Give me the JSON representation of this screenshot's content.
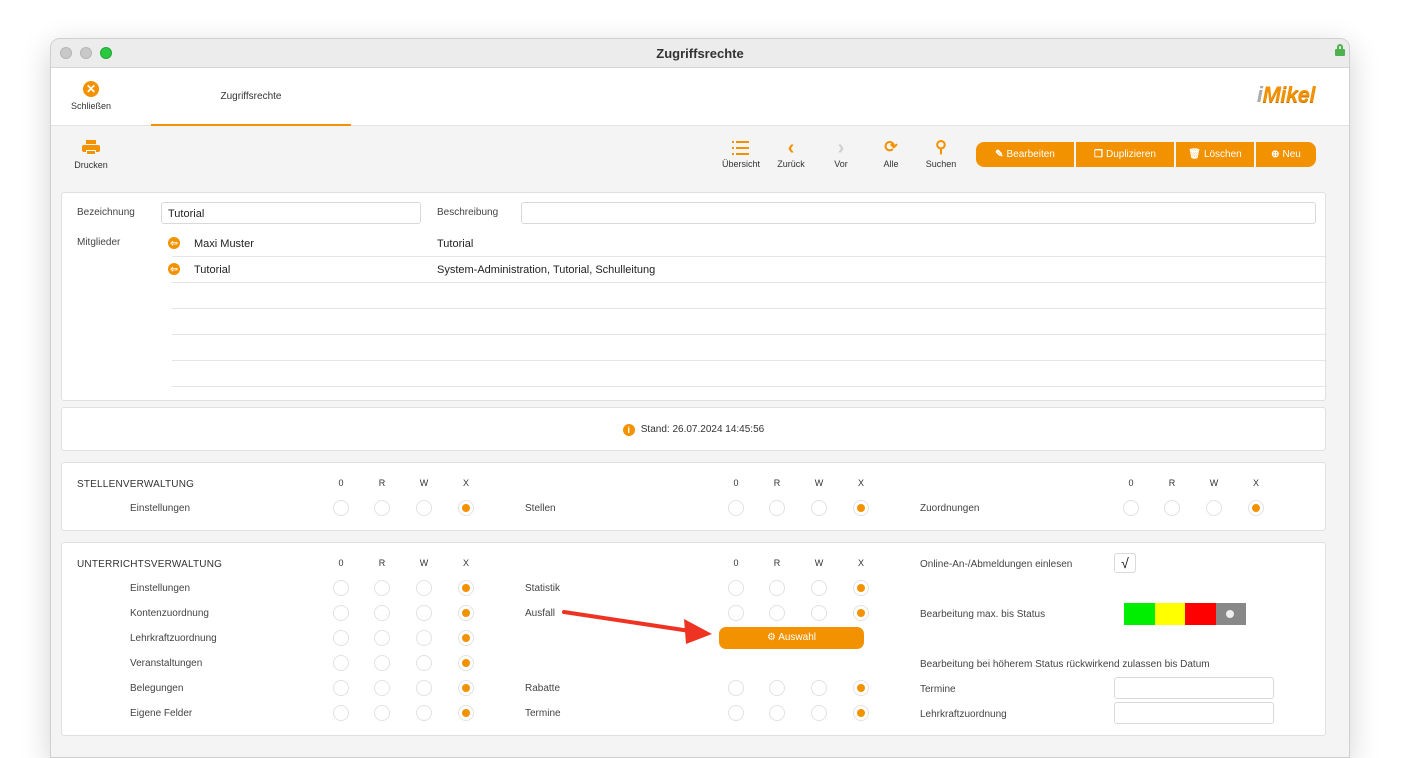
{
  "window": {
    "title": "Zugriffsrechte"
  },
  "tabbar": {
    "close_label": "Schließen",
    "tab_label": "Zugriffsrechte",
    "logo_prefix": "i",
    "logo_rest": "Mikel"
  },
  "toolbar": {
    "print_label": "Drucken",
    "nav": [
      {
        "label": "Übersicht",
        "icon": "list-icon"
      },
      {
        "label": "Zurück",
        "icon": "chevron-left-icon"
      },
      {
        "label": "Vor",
        "icon": "chevron-right-icon"
      },
      {
        "label": "Alle",
        "icon": "refresh-icon"
      },
      {
        "label": "Suchen",
        "icon": "search-icon"
      }
    ],
    "actions": {
      "edit": "Bearbeiten",
      "duplicate": "Duplizieren",
      "delete": "Löschen",
      "new": "Neu"
    }
  },
  "form": {
    "name_label": "Bezeichnung",
    "name_value": "Tutorial",
    "desc_label": "Beschreibung",
    "desc_value": "",
    "members_label": "Mitglieder",
    "members": [
      {
        "name": "Maxi Muster",
        "groups": "Tutorial"
      },
      {
        "name": "Tutorial",
        "groups": "System-Administration, Tutorial, Schulleitung"
      }
    ]
  },
  "stand": {
    "text": "Stand: 26.07.2024 14:45:56"
  },
  "columns": [
    "0",
    "R",
    "W",
    "X"
  ],
  "stellen": {
    "title": "STELLENVERWALTUNG",
    "rows": [
      {
        "label": "Einstellungen",
        "value": "X"
      },
      {
        "label": "Stellen",
        "value": "X"
      },
      {
        "label": "Zuordnungen",
        "value": "X"
      }
    ]
  },
  "unterricht": {
    "title": "UNTERRICHTSVERWALTUNG",
    "left_rows": [
      {
        "label": "Einstellungen",
        "value": "X"
      },
      {
        "label": "Kontenzuordnung",
        "value": "X"
      },
      {
        "label": "Lehrkraftzuordnung",
        "value": "X"
      },
      {
        "label": "Veranstaltungen",
        "value": "X"
      },
      {
        "label": "Belegungen",
        "value": "X"
      },
      {
        "label": "Eigene Felder",
        "value": "X"
      }
    ],
    "mid_rows": [
      {
        "label": "Statistik",
        "value": "X"
      },
      {
        "label": "Ausfall",
        "value": "X"
      },
      {
        "label": "Rabatte",
        "value": "X"
      },
      {
        "label": "Termine",
        "value": "X"
      }
    ],
    "auswahl_label": "Auswahl",
    "online_label": "Online-An-/Abmeldungen einlesen",
    "online_checked": "√",
    "status_label": "Bearbeitung max. bis Status",
    "status_colors": [
      "#00ee00",
      "#ffff00",
      "#ff0000",
      "#888888"
    ],
    "retro_label": "Bearbeitung bei höherem Status rückwirkend zulassen bis Datum",
    "termine_label": "Termine",
    "termine_value": "",
    "lehrkraft_label": "Lehrkraftzuordnung",
    "lehrkraft_value": ""
  },
  "colors": {
    "accent": "#f39200",
    "arrow": "#ee3322"
  }
}
